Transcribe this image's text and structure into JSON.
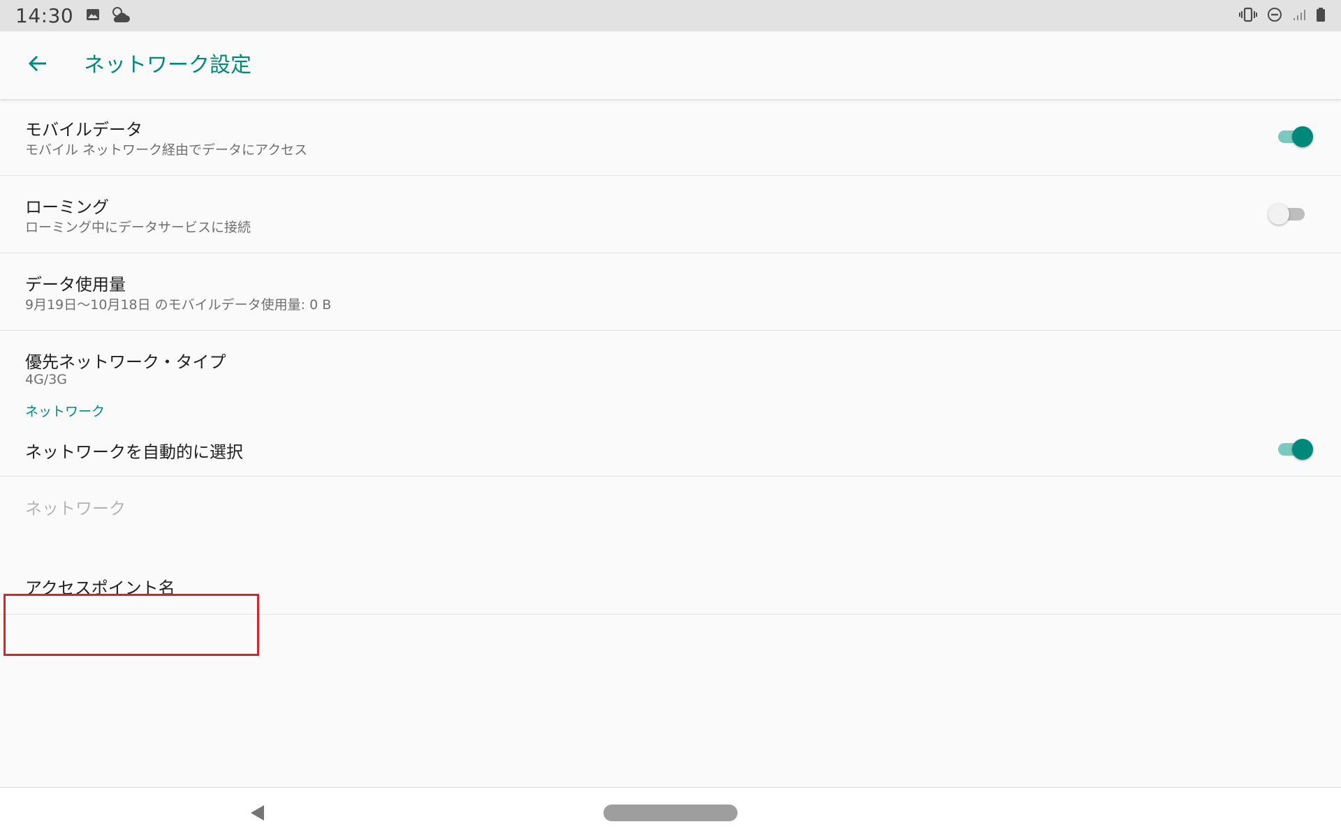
{
  "status_bar": {
    "time": "14:30",
    "left_icons": [
      "image-icon",
      "weather-icon"
    ],
    "right_icons": [
      "vibrate-icon",
      "do-not-disturb-icon",
      "signal-icon",
      "battery-icon"
    ]
  },
  "app_bar": {
    "title": "ネットワーク設定",
    "back_icon": "arrow-back-icon"
  },
  "settings": {
    "mobile_data": {
      "title": "モバイルデータ",
      "summary": "モバイル ネットワーク経由でデータにアクセス",
      "enabled": true
    },
    "roaming": {
      "title": "ローミング",
      "summary": "ローミング中にデータサービスに接続",
      "enabled": false
    },
    "data_usage": {
      "title": "データ使用量",
      "summary": "9月19日〜10月18日 のモバイルデータ使用量: 0 B"
    },
    "preferred_network_type": {
      "title": "優先ネットワーク・タイプ",
      "summary": "4G/3G"
    },
    "network_category": {
      "label": "ネットワーク"
    },
    "auto_select_network": {
      "title": "ネットワークを自動的に選択",
      "enabled": true
    },
    "network": {
      "title": "ネットワーク"
    },
    "access_point_names": {
      "title": "アクセスポイント名"
    }
  },
  "nav_bar": {
    "icons": [
      "nav-back-icon",
      "home-pill-icon"
    ]
  },
  "colors": {
    "accent": "#00897b",
    "highlight": "#d9222a",
    "status_bar_bg": "#e2e2e2",
    "background": "#fafafa"
  }
}
